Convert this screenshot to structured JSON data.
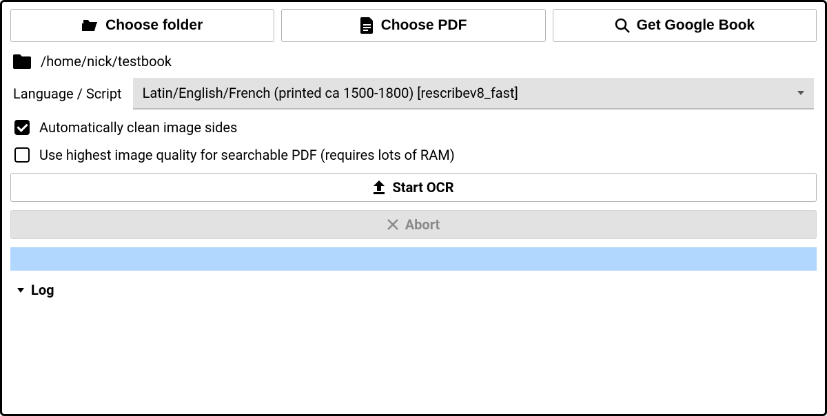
{
  "buttons": {
    "choose_folder": "Choose folder",
    "choose_pdf": "Choose PDF",
    "get_google_book": "Get Google Book",
    "start_ocr": "Start OCR",
    "abort": "Abort"
  },
  "path": "/home/nick/testbook",
  "language": {
    "label": "Language / Script",
    "selected": "Latin/English/French (printed ca 1500-1800) [rescribev8_fast]"
  },
  "options": {
    "clean_sides": "Automatically clean image sides",
    "clean_sides_checked": true,
    "highest_quality": "Use highest image quality for searchable PDF (requires lots of RAM)",
    "highest_quality_checked": false
  },
  "log": {
    "label": "Log"
  }
}
